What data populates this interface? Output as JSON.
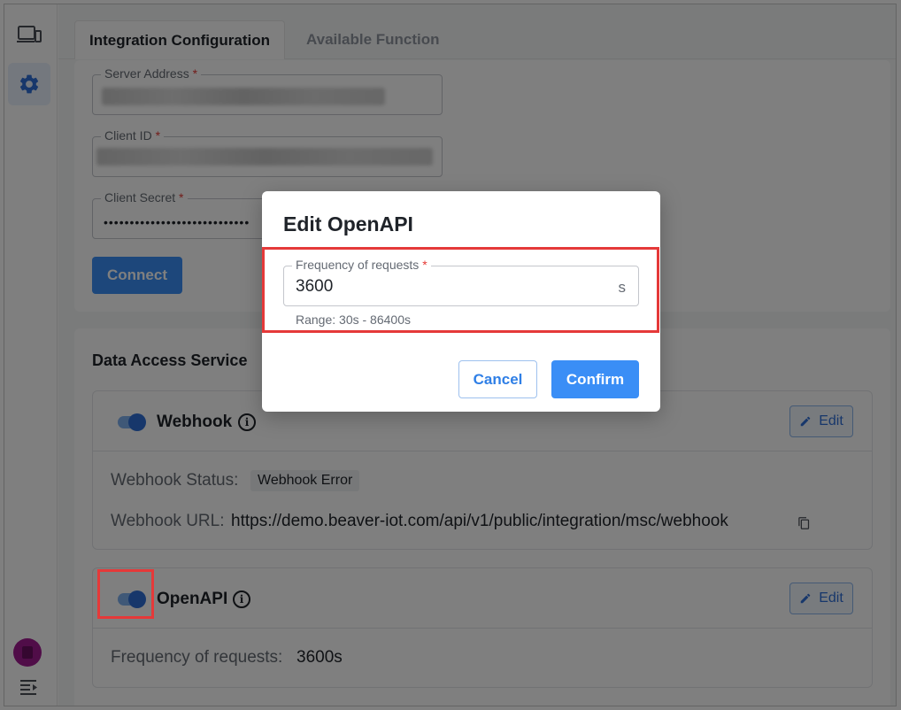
{
  "sidebar": {
    "items": [
      {
        "icon": "devices-icon"
      },
      {
        "icon": "gear-icon",
        "active": true
      }
    ],
    "bottom": {
      "avatar": "avatar",
      "menu_icon": "menu-collapse-icon"
    }
  },
  "tabs": [
    {
      "label": "Integration Configuration",
      "active": true
    },
    {
      "label": "Available Function",
      "active": false
    }
  ],
  "config": {
    "server_address_label": "Server Address",
    "client_id_label": "Client ID",
    "client_secret_label": "Client Secret",
    "client_secret_value": "••••••••••••••••••••••••••••",
    "required_mark": "*",
    "connect_label": "Connect"
  },
  "data_access": {
    "title": "Data Access Service",
    "webhook": {
      "name": "Webhook",
      "enabled": true,
      "edit_label": "Edit",
      "status_label": "Webhook Status:",
      "status_value": "Webhook Error",
      "url_label": "Webhook URL:",
      "url_value": "https://demo.beaver-iot.com/api/v1/public/integration/msc/webhook"
    },
    "openapi": {
      "name": "OpenAPI",
      "enabled": true,
      "edit_label": "Edit",
      "frequency_label": "Frequency of requests:",
      "frequency_value": "3600s"
    }
  },
  "modal": {
    "title": "Edit OpenAPI",
    "field_label": "Frequency of requests",
    "required_mark": "*",
    "field_value": "3600",
    "unit": "s",
    "helper": "Range: 30s - 86400s",
    "cancel_label": "Cancel",
    "confirm_label": "Confirm"
  },
  "colors": {
    "primary": "#3a8ef6",
    "highlight": "#e53939",
    "required": "#e53935"
  }
}
